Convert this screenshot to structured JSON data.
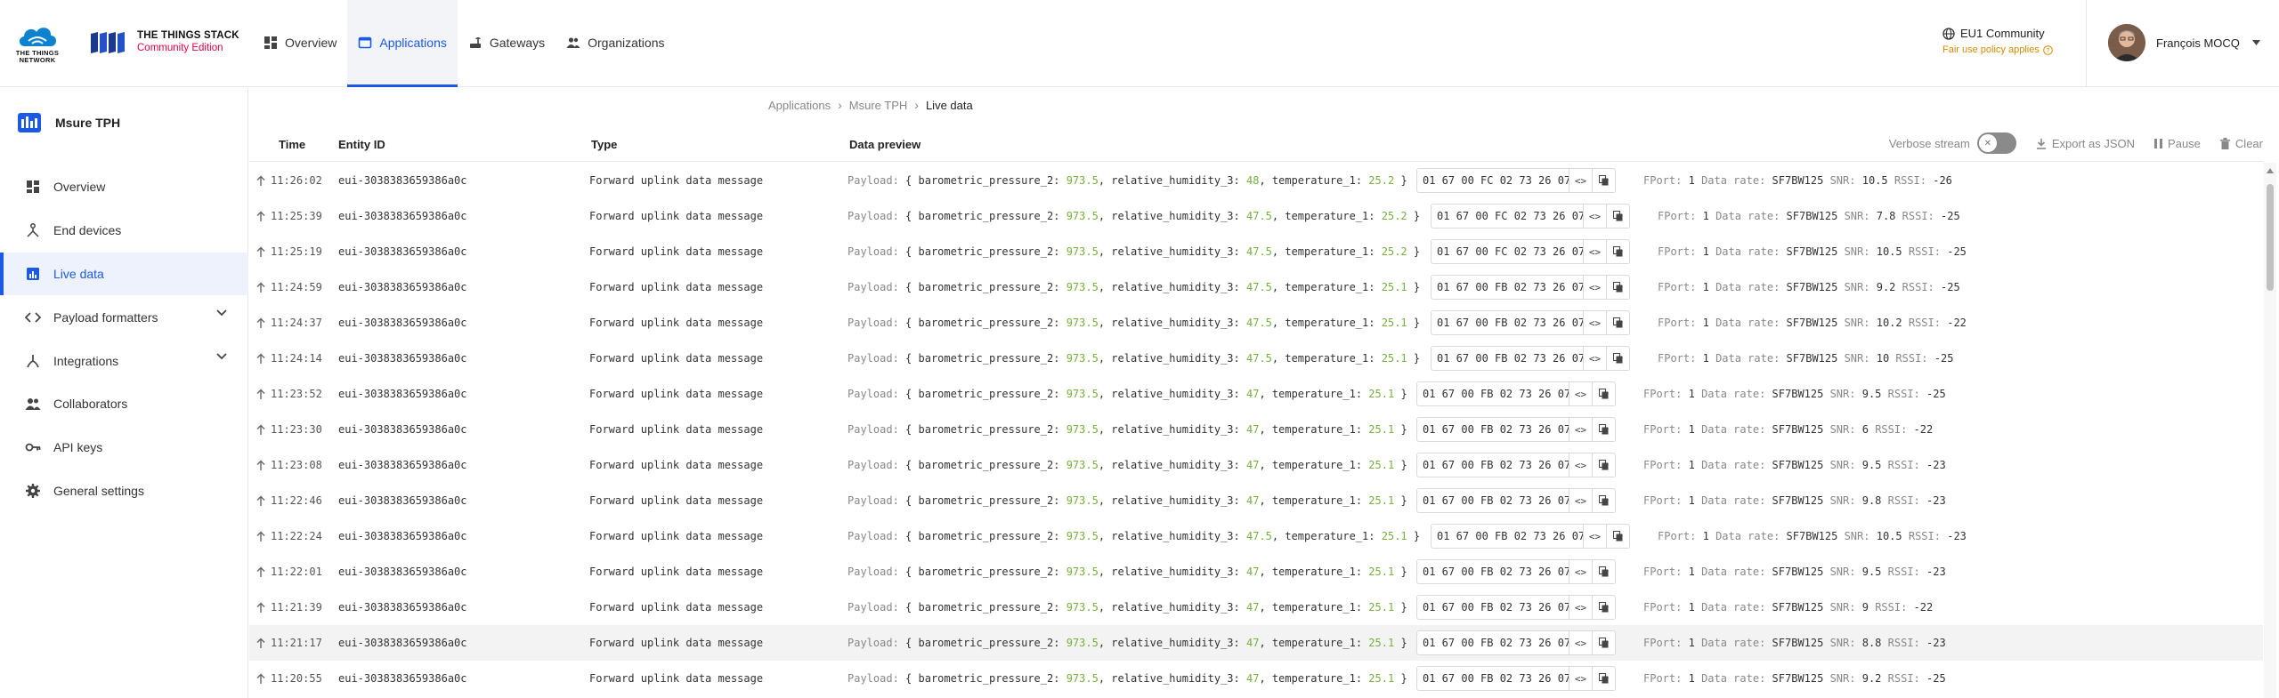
{
  "brand": {
    "ttn_text": "THE THINGS NETWORK",
    "stack_title": "THE THINGS STACK",
    "stack_subtitle": "Community Edition"
  },
  "nav": {
    "items": [
      {
        "label": "Overview",
        "icon": "overview-icon",
        "active": false
      },
      {
        "label": "Applications",
        "icon": "applications-icon",
        "active": true
      },
      {
        "label": "Gateways",
        "icon": "gateway-icon",
        "active": false
      },
      {
        "label": "Organizations",
        "icon": "organizations-icon",
        "active": false
      }
    ]
  },
  "region": {
    "name": "EU1 Community",
    "notice": "Fair use policy applies"
  },
  "user": {
    "name": "François MOCQ"
  },
  "sidebar": {
    "app_name": "Msure TPH",
    "items": [
      {
        "label": "Overview",
        "icon": "dashboard-icon",
        "active": false
      },
      {
        "label": "End devices",
        "icon": "end-devices-icon",
        "active": false
      },
      {
        "label": "Live data",
        "icon": "live-data-icon",
        "active": true
      },
      {
        "label": "Payload formatters",
        "icon": "code-icon",
        "active": false,
        "expandable": true
      },
      {
        "label": "Integrations",
        "icon": "integrations-icon",
        "active": false,
        "expandable": true
      },
      {
        "label": "Collaborators",
        "icon": "collaborators-icon",
        "active": false
      },
      {
        "label": "API keys",
        "icon": "key-icon",
        "active": false
      },
      {
        "label": "General settings",
        "icon": "settings-icon",
        "active": false
      }
    ]
  },
  "breadcrumb": {
    "items": [
      "Applications",
      "Msure TPH",
      "Live data"
    ]
  },
  "table": {
    "headers": {
      "time": "Time",
      "entity": "Entity ID",
      "type": "Type",
      "preview": "Data preview"
    },
    "toolbar": {
      "verbose": "Verbose stream",
      "export": "Export as JSON",
      "pause": "Pause",
      "clear": "Clear"
    },
    "labels": {
      "payload": "Payload:",
      "fport": "FPort:",
      "datarate": "Data rate:",
      "snr": "SNR:",
      "rssi": "RSSI:",
      "k_pressure": "barometric_pressure_2:",
      "k_humidity": "relative_humidity_3:",
      "k_temp": "temperature_1:"
    },
    "rows": [
      {
        "time": "11:26:02",
        "entity": "eui-3038383659386a0c",
        "type": "Forward uplink data message",
        "pressure": "973.5",
        "humidity": "48",
        "temperature": "25.2",
        "raw": "01 67 00 FC 02 73 26 07 …",
        "fport": "1",
        "datarate": "SF7BW125",
        "snr": "10.5",
        "rssi": "-26",
        "highlight": false
      },
      {
        "time": "11:25:39",
        "entity": "eui-3038383659386a0c",
        "type": "Forward uplink data message",
        "pressure": "973.5",
        "humidity": "47.5",
        "temperature": "25.2",
        "raw": "01 67 00 FC 02 73 26 07 …",
        "fport": "1",
        "datarate": "SF7BW125",
        "snr": "7.8",
        "rssi": "-25",
        "highlight": false
      },
      {
        "time": "11:25:19",
        "entity": "eui-3038383659386a0c",
        "type": "Forward uplink data message",
        "pressure": "973.5",
        "humidity": "47.5",
        "temperature": "25.2",
        "raw": "01 67 00 FC 02 73 26 07 …",
        "fport": "1",
        "datarate": "SF7BW125",
        "snr": "10.5",
        "rssi": "-25",
        "highlight": false
      },
      {
        "time": "11:24:59",
        "entity": "eui-3038383659386a0c",
        "type": "Forward uplink data message",
        "pressure": "973.5",
        "humidity": "47.5",
        "temperature": "25.1",
        "raw": "01 67 00 FB 02 73 26 07 …",
        "fport": "1",
        "datarate": "SF7BW125",
        "snr": "9.2",
        "rssi": "-25",
        "highlight": false
      },
      {
        "time": "11:24:37",
        "entity": "eui-3038383659386a0c",
        "type": "Forward uplink data message",
        "pressure": "973.5",
        "humidity": "47.5",
        "temperature": "25.1",
        "raw": "01 67 00 FB 02 73 26 07 …",
        "fport": "1",
        "datarate": "SF7BW125",
        "snr": "10.2",
        "rssi": "-22",
        "highlight": false
      },
      {
        "time": "11:24:14",
        "entity": "eui-3038383659386a0c",
        "type": "Forward uplink data message",
        "pressure": "973.5",
        "humidity": "47.5",
        "temperature": "25.1",
        "raw": "01 67 00 FB 02 73 26 07 …",
        "fport": "1",
        "datarate": "SF7BW125",
        "snr": "10",
        "rssi": "-25",
        "highlight": false
      },
      {
        "time": "11:23:52",
        "entity": "eui-3038383659386a0c",
        "type": "Forward uplink data message",
        "pressure": "973.5",
        "humidity": "47",
        "temperature": "25.1",
        "raw": "01 67 00 FB 02 73 26 07 …",
        "fport": "1",
        "datarate": "SF7BW125",
        "snr": "9.5",
        "rssi": "-25",
        "highlight": false
      },
      {
        "time": "11:23:30",
        "entity": "eui-3038383659386a0c",
        "type": "Forward uplink data message",
        "pressure": "973.5",
        "humidity": "47",
        "temperature": "25.1",
        "raw": "01 67 00 FB 02 73 26 07 …",
        "fport": "1",
        "datarate": "SF7BW125",
        "snr": "6",
        "rssi": "-22",
        "highlight": false
      },
      {
        "time": "11:23:08",
        "entity": "eui-3038383659386a0c",
        "type": "Forward uplink data message",
        "pressure": "973.5",
        "humidity": "47",
        "temperature": "25.1",
        "raw": "01 67 00 FB 02 73 26 07 …",
        "fport": "1",
        "datarate": "SF7BW125",
        "snr": "9.5",
        "rssi": "-23",
        "highlight": false
      },
      {
        "time": "11:22:46",
        "entity": "eui-3038383659386a0c",
        "type": "Forward uplink data message",
        "pressure": "973.5",
        "humidity": "47",
        "temperature": "25.1",
        "raw": "01 67 00 FB 02 73 26 07 …",
        "fport": "1",
        "datarate": "SF7BW125",
        "snr": "9.8",
        "rssi": "-23",
        "highlight": false
      },
      {
        "time": "11:22:24",
        "entity": "eui-3038383659386a0c",
        "type": "Forward uplink data message",
        "pressure": "973.5",
        "humidity": "47.5",
        "temperature": "25.1",
        "raw": "01 67 00 FB 02 73 26 07 …",
        "fport": "1",
        "datarate": "SF7BW125",
        "snr": "10.5",
        "rssi": "-23",
        "highlight": false
      },
      {
        "time": "11:22:01",
        "entity": "eui-3038383659386a0c",
        "type": "Forward uplink data message",
        "pressure": "973.5",
        "humidity": "47",
        "temperature": "25.1",
        "raw": "01 67 00 FB 02 73 26 07 …",
        "fport": "1",
        "datarate": "SF7BW125",
        "snr": "9.5",
        "rssi": "-23",
        "highlight": false
      },
      {
        "time": "11:21:39",
        "entity": "eui-3038383659386a0c",
        "type": "Forward uplink data message",
        "pressure": "973.5",
        "humidity": "47",
        "temperature": "25.1",
        "raw": "01 67 00 FB 02 73 26 07 …",
        "fport": "1",
        "datarate": "SF7BW125",
        "snr": "9",
        "rssi": "-22",
        "highlight": false
      },
      {
        "time": "11:21:17",
        "entity": "eui-3038383659386a0c",
        "type": "Forward uplink data message",
        "pressure": "973.5",
        "humidity": "47",
        "temperature": "25.1",
        "raw": "01 67 00 FB 02 73 26 07 …",
        "fport": "1",
        "datarate": "SF7BW125",
        "snr": "8.8",
        "rssi": "-23",
        "highlight": true
      },
      {
        "time": "11:20:55",
        "entity": "eui-3038383659386a0c",
        "type": "Forward uplink data message",
        "pressure": "973.5",
        "humidity": "47",
        "temperature": "25.1",
        "raw": "01 67 00 FB 02 73 26 07 …",
        "fport": "1",
        "datarate": "SF7BW125",
        "snr": "9.2",
        "rssi": "-25",
        "highlight": false
      }
    ]
  },
  "colors": {
    "accent": "#1c5ae5",
    "brand_red": "#e40046",
    "number_green": "#74b13e",
    "notice_orange": "#d68b00"
  }
}
